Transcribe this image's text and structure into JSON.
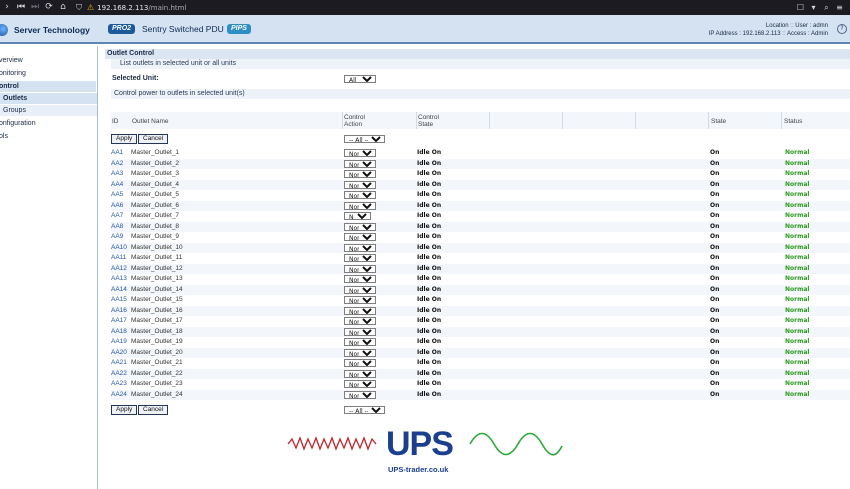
{
  "browser": {
    "address_host": "192.168.2.113",
    "address_path": "/main.html"
  },
  "header": {
    "brand": "Server Technology",
    "badge_left": "PRO2",
    "product": "Sentry Switched PDU",
    "badge_right": "PIPS",
    "location_label": "Location",
    "user_label": "User",
    "user_value": "admn",
    "ip_label": "IP Address",
    "ip_value": "192.168.2.113",
    "access_label": "Access",
    "access_value": "Admin"
  },
  "sidebar": {
    "items": [
      {
        "label": "verview"
      },
      {
        "label": "onitoring"
      },
      {
        "label": "ontrol"
      },
      {
        "label": "Outlets"
      },
      {
        "label": "Groups"
      },
      {
        "label": "onfiguration"
      },
      {
        "label": "ols"
      }
    ]
  },
  "main": {
    "section_title": "Outlet Control",
    "subtitle_list": "List outlets in selected unit or all units",
    "selected_unit_label": "Selected Unit:",
    "selected_unit_value": "All",
    "subtitle_control": "Control power to outlets in selected unit(s)",
    "columns": {
      "id": "ID",
      "name": "Outlet Name",
      "control_action_1": "Control",
      "control_action_2": "Action",
      "control_state_1": "Control",
      "control_state_2": "State",
      "state": "State",
      "status": "Status"
    },
    "apply_label": "Apply",
    "cancel_label": "Cancel",
    "all_select_value": "-- All --",
    "row_select_value": "None",
    "outlets": [
      {
        "id": "AA1",
        "name": "Master_Outlet_1",
        "control_state": "Idle On",
        "state": "On",
        "status": "Normal"
      },
      {
        "id": "AA2",
        "name": "Master_Outlet_2",
        "control_state": "Idle On",
        "state": "On",
        "status": "Normal"
      },
      {
        "id": "AA3",
        "name": "Master_Outlet_3",
        "control_state": "Idle On",
        "state": "On",
        "status": "Normal"
      },
      {
        "id": "AA4",
        "name": "Master_Outlet_4",
        "control_state": "Idle On",
        "state": "On",
        "status": "Normal"
      },
      {
        "id": "AA5",
        "name": "Master_Outlet_5",
        "control_state": "Idle On",
        "state": "On",
        "status": "Normal"
      },
      {
        "id": "AA6",
        "name": "Master_Outlet_6",
        "control_state": "Idle On",
        "state": "On",
        "status": "Normal"
      },
      {
        "id": "AA7",
        "name": "Master_Outlet_7",
        "control_state": "Idle On",
        "state": "On",
        "status": "Normal"
      },
      {
        "id": "AA8",
        "name": "Master_Outlet_8",
        "control_state": "Idle On",
        "state": "On",
        "status": "Normal"
      },
      {
        "id": "AA9",
        "name": "Master_Outlet_9",
        "control_state": "Idle On",
        "state": "On",
        "status": "Normal"
      },
      {
        "id": "AA10",
        "name": "Master_Outlet_10",
        "control_state": "Idle On",
        "state": "On",
        "status": "Normal"
      },
      {
        "id": "AA11",
        "name": "Master_Outlet_11",
        "control_state": "Idle On",
        "state": "On",
        "status": "Normal"
      },
      {
        "id": "AA12",
        "name": "Master_Outlet_12",
        "control_state": "Idle On",
        "state": "On",
        "status": "Normal"
      },
      {
        "id": "AA13",
        "name": "Master_Outlet_13",
        "control_state": "Idle On",
        "state": "On",
        "status": "Normal"
      },
      {
        "id": "AA14",
        "name": "Master_Outlet_14",
        "control_state": "Idle On",
        "state": "On",
        "status": "Normal"
      },
      {
        "id": "AA15",
        "name": "Master_Outlet_15",
        "control_state": "Idle On",
        "state": "On",
        "status": "Normal"
      },
      {
        "id": "AA16",
        "name": "Master_Outlet_16",
        "control_state": "Idle On",
        "state": "On",
        "status": "Normal"
      },
      {
        "id": "AA17",
        "name": "Master_Outlet_17",
        "control_state": "Idle On",
        "state": "On",
        "status": "Normal"
      },
      {
        "id": "AA18",
        "name": "Master_Outlet_18",
        "control_state": "Idle On",
        "state": "On",
        "status": "Normal"
      },
      {
        "id": "AA19",
        "name": "Master_Outlet_19",
        "control_state": "Idle On",
        "state": "On",
        "status": "Normal"
      },
      {
        "id": "AA20",
        "name": "Master_Outlet_20",
        "control_state": "Idle On",
        "state": "On",
        "status": "Normal"
      },
      {
        "id": "AA21",
        "name": "Master_Outlet_21",
        "control_state": "Idle On",
        "state": "On",
        "status": "Normal"
      },
      {
        "id": "AA22",
        "name": "Master_Outlet_22",
        "control_state": "Idle On",
        "state": "On",
        "status": "Normal"
      },
      {
        "id": "AA23",
        "name": "Master_Outlet_23",
        "control_state": "Idle On",
        "state": "On",
        "status": "Normal"
      },
      {
        "id": "AA24",
        "name": "Master_Outlet_24",
        "control_state": "Idle On",
        "state": "On",
        "status": "Normal"
      }
    ]
  },
  "logo": {
    "letters": "UPS",
    "site": "UPS-trader.co.uk"
  },
  "colors": {
    "header_bg": "#d4e2f2",
    "status_normal": "#2a9a1c",
    "id_link": "#2255aa",
    "logo_blue": "#1b3f8f",
    "wave_red": "#c0242a",
    "wave_green": "#2aa83a"
  }
}
